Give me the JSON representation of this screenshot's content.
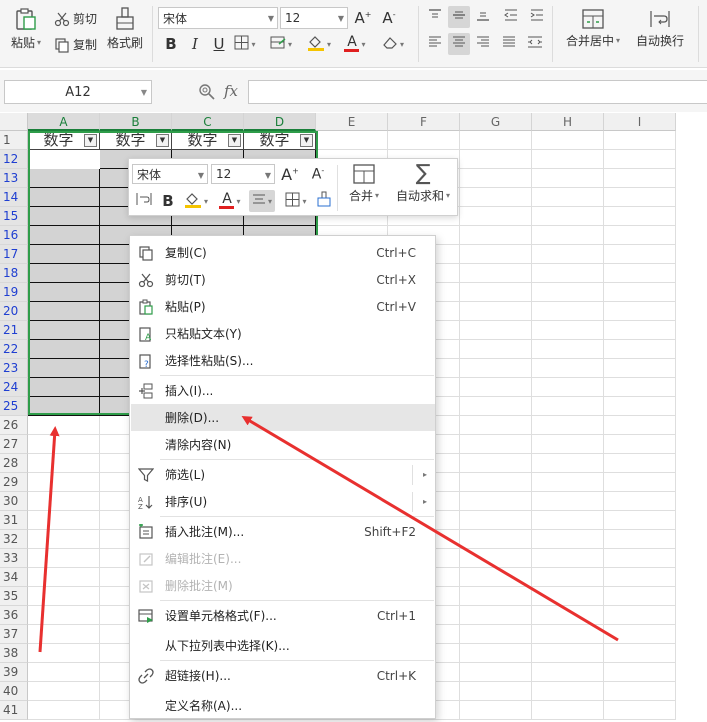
{
  "ribbon": {
    "paste": "粘贴",
    "cut": "剪切",
    "copy": "复制",
    "format_painter": "格式刷",
    "font_name": "宋体",
    "font_size": "12",
    "merge_center": "合并居中",
    "wrap_text": "自动换行"
  },
  "formula_bar": {
    "name_box": "A12",
    "fx": "fx",
    "value": ""
  },
  "columns": [
    "A",
    "B",
    "C",
    "D",
    "E",
    "F",
    "G",
    "H",
    "I"
  ],
  "rows": [
    "1",
    "12",
    "13",
    "14",
    "15",
    "16",
    "17",
    "18",
    "19",
    "20",
    "21",
    "22",
    "23",
    "24",
    "25",
    "26",
    "27",
    "28",
    "29",
    "30",
    "31",
    "32",
    "33",
    "34",
    "35",
    "36",
    "37",
    "38",
    "39",
    "40",
    "41"
  ],
  "header_cells": [
    "数字",
    "数字",
    "数字",
    "数字"
  ],
  "mini_toolbar": {
    "font_name": "宋体",
    "font_size": "12",
    "merge": "合并",
    "autosum": "自动求和"
  },
  "context_menu": {
    "items": [
      {
        "label": "复制(C)",
        "shortcut": "Ctrl+C"
      },
      {
        "label": "剪切(T)",
        "shortcut": "Ctrl+X"
      },
      {
        "label": "粘贴(P)",
        "shortcut": "Ctrl+V"
      },
      {
        "label": "只粘贴文本(Y)",
        "shortcut": ""
      },
      {
        "label": "选择性粘贴(S)...",
        "shortcut": ""
      },
      {
        "label": "插入(I)...",
        "shortcut": ""
      },
      {
        "label": "删除(D)...",
        "shortcut": ""
      },
      {
        "label": "清除内容(N)",
        "shortcut": ""
      },
      {
        "label": "筛选(L)",
        "shortcut": ""
      },
      {
        "label": "排序(U)",
        "shortcut": ""
      },
      {
        "label": "插入批注(M)...",
        "shortcut": "Shift+F2"
      },
      {
        "label": "编辑批注(E)...",
        "shortcut": ""
      },
      {
        "label": "删除批注(M)",
        "shortcut": ""
      },
      {
        "label": "设置单元格格式(F)...",
        "shortcut": "Ctrl+1"
      },
      {
        "label": "从下拉列表中选择(K)...",
        "shortcut": ""
      },
      {
        "label": "超链接(H)...",
        "shortcut": "Ctrl+K"
      },
      {
        "label": "定义名称(A)...",
        "shortcut": ""
      }
    ]
  },
  "colors": {
    "selection_border": "#2f9d4a",
    "selected_row_header": "#1f3fd1",
    "annotation_arrow": "#e8302f",
    "menu_hover": "#e6e6e6"
  }
}
